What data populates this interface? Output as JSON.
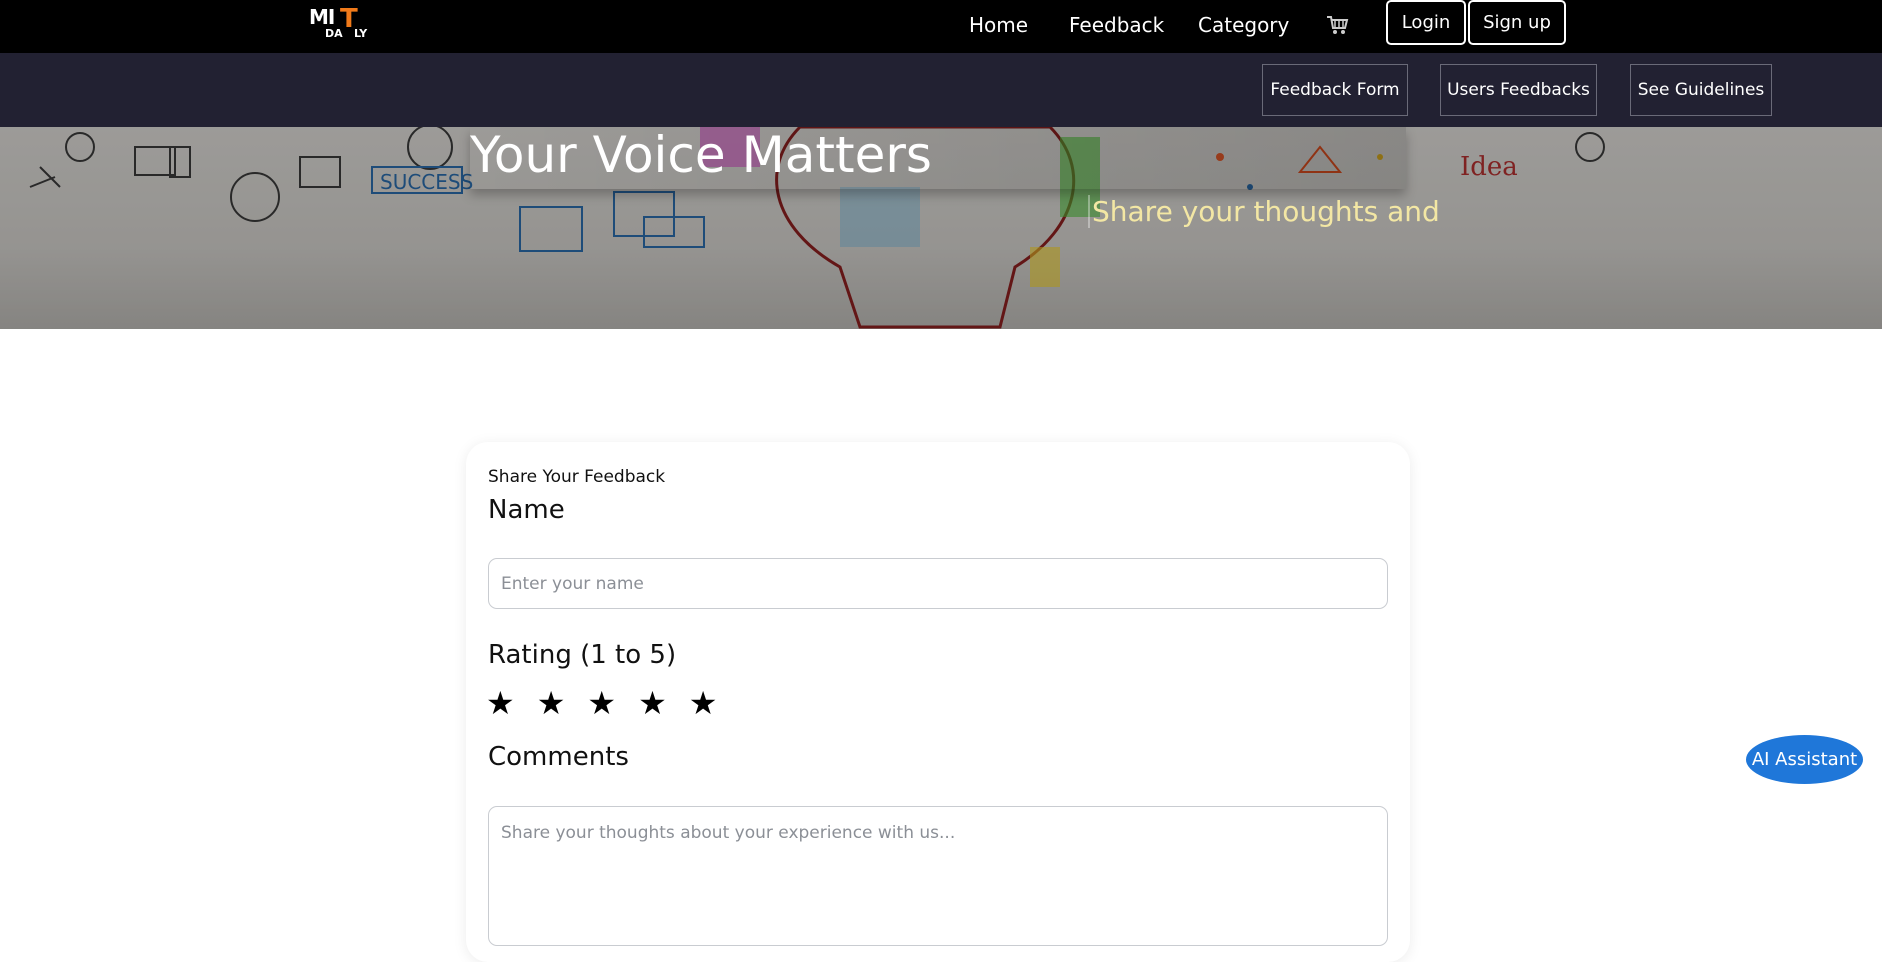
{
  "logo": {
    "mi": "MI",
    "t": "T",
    "da": "DA",
    "ly": "LY"
  },
  "nav": {
    "home": "Home",
    "feedback": "Feedback",
    "category": "Category",
    "cart_icon": "cart-icon",
    "login": "Login",
    "signup": "Sign up"
  },
  "subnav": {
    "feedback_form": "Feedback Form",
    "users_feedbacks": "Users Feedbacks",
    "see_guidelines": "See Guidelines"
  },
  "hero": {
    "title": "Your Voice Matters",
    "subtitle": "Share your thoughts and"
  },
  "form": {
    "heading": "Share Your Feedback",
    "name_label": "Name",
    "name_placeholder": "Enter your name",
    "rating_label": "Rating (1 to 5)",
    "stars": [
      "★",
      "★",
      "★",
      "★",
      "★"
    ],
    "comments_label": "Comments",
    "comments_placeholder": "Share your thoughts about your experience with us..."
  },
  "ai_assistant": "AI Assistant",
  "colors": {
    "topbar": "#000000",
    "subbar": "#222132",
    "logo_accent": "#f07a1a",
    "hero_subtitle": "#f3e7a4",
    "ai_button": "#1f77d9"
  }
}
